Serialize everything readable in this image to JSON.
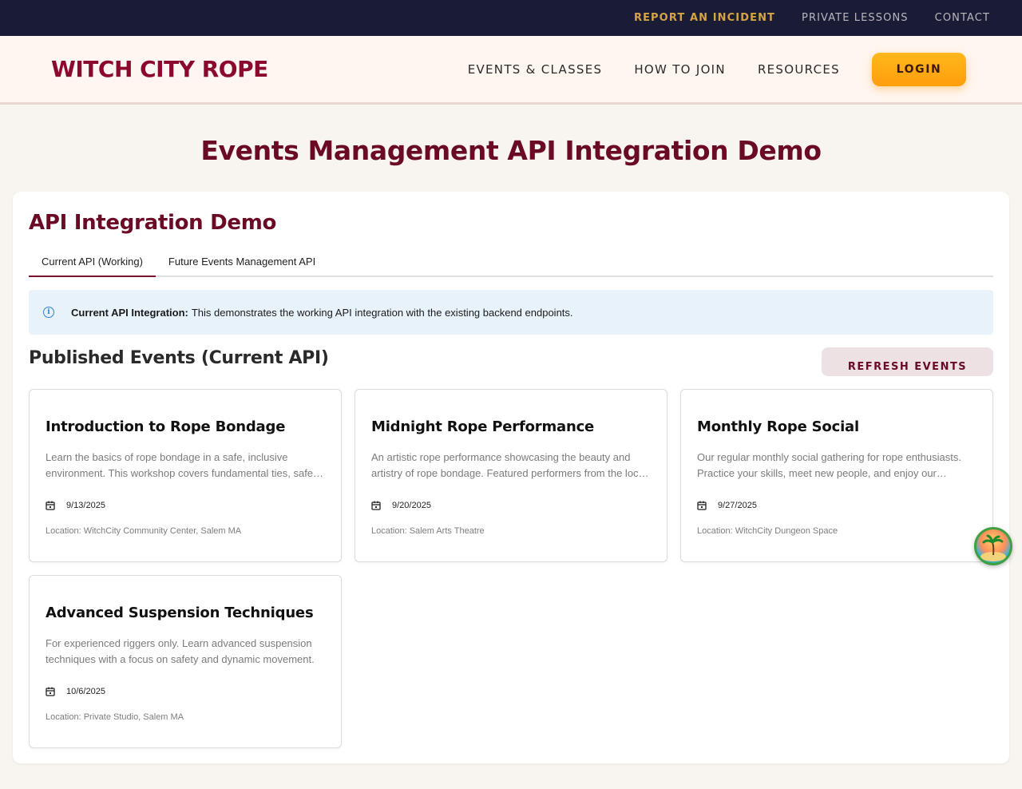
{
  "utility_nav": {
    "report_incident": "REPORT AN INCIDENT",
    "private_lessons": "PRIVATE LESSONS",
    "contact": "CONTACT"
  },
  "header": {
    "brand": "WITCH CITY ROPE",
    "nav": {
      "events_classes": "EVENTS & CLASSES",
      "how_to_join": "HOW TO JOIN",
      "resources": "RESOURCES"
    },
    "login": "LOGIN"
  },
  "page_title": "Events Management API Integration Demo",
  "demo": {
    "title": "API Integration Demo",
    "tabs": [
      "Current API (Working)",
      "Future Events Management API"
    ],
    "alert": {
      "strong": "Current API Integration:",
      "text": "This demonstrates the working API integration with the existing backend endpoints."
    },
    "section_title": "Published Events (Current API)",
    "refresh_label": "REFRESH EVENTS",
    "events": [
      {
        "title": "Introduction to Rope Bondage",
        "description": "Learn the basics of rope bondage in a safe, inclusive environment. This workshop covers fundamental ties, safety, and communication.",
        "date": "9/13/2025",
        "location": "Location: WitchCity Community Center, Salem MA"
      },
      {
        "title": "Midnight Rope Performance",
        "description": "An artistic rope performance showcasing the beauty and artistry of rope bondage. Featured performers from the local community.",
        "date": "9/20/2025",
        "location": "Location: Salem Arts Theatre"
      },
      {
        "title": "Monthly Rope Social",
        "description": "Our regular monthly social gathering for rope enthusiasts. Practice your skills, meet new people, and enjoy our community.",
        "date": "9/27/2025",
        "location": "Location: WitchCity Dungeon Space"
      },
      {
        "title": "Advanced Suspension Techniques",
        "description": "For experienced riggers only. Learn advanced suspension techniques with a focus on safety and dynamic movement.",
        "date": "10/6/2025",
        "location": "Location: Private Studio, Salem MA"
      }
    ]
  },
  "icons": {
    "info": "info-icon",
    "calendar": "calendar-icon",
    "widget": "beach-island-icon"
  },
  "colors": {
    "brand": "#8b0a2c",
    "accent": "#ffb81c",
    "utility_bar": "#1a1c35",
    "incident_link": "#d4a445"
  }
}
